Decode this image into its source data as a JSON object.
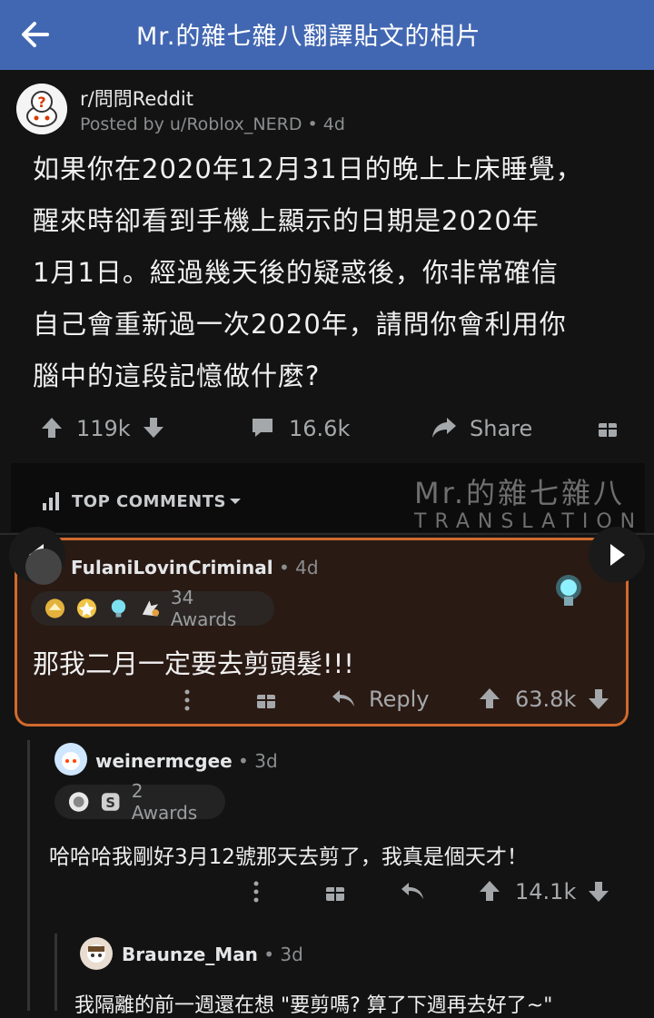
{
  "header": {
    "title": "Mr.的雜七雜八翻譯貼文的相片"
  },
  "post": {
    "subreddit": "r/問問Reddit",
    "meta": "Posted by u/Roblox_NERD • 4d",
    "lines": [
      "如果你在2020年12月31日的晚上上床睡覺，",
      "醒來時卻看到手機上顯示的日期是2020年",
      "1月1日。經過幾天後的疑惑後，你非常確信",
      "自己會重新過一次2020年，請問你會利用你",
      "腦中的這段記憶做什麼?"
    ],
    "upvotes": "119k",
    "comments": "16.6k",
    "share_label": "Share"
  },
  "sort": {
    "label": "TOP COMMENTS"
  },
  "watermark": {
    "line1": "Mr.的雜七雜八",
    "line2": "TRANSLATION"
  },
  "comments": [
    {
      "username": "FulaniLovinCriminal",
      "age": " • 4d",
      "awards": "34 Awards",
      "body": "那我二月一定要去剪頭髮!!!",
      "reply_label": "Reply",
      "score": "63.8k"
    },
    {
      "username": "weinermcgee",
      "age": " • 3d",
      "awards": "2 Awards",
      "body": "哈哈哈我剛好3月12號那天去剪了，我真是個天才！",
      "score": "14.1k"
    },
    {
      "username": "Braunze_Man",
      "age": " • 3d",
      "body": "我隔離的前一週還在想 \"要剪嗎? 算了下週再去好了~\""
    }
  ],
  "colors": {
    "header": "#4267b2",
    "background": "#131313",
    "highlight_border": "#d06a2e"
  }
}
